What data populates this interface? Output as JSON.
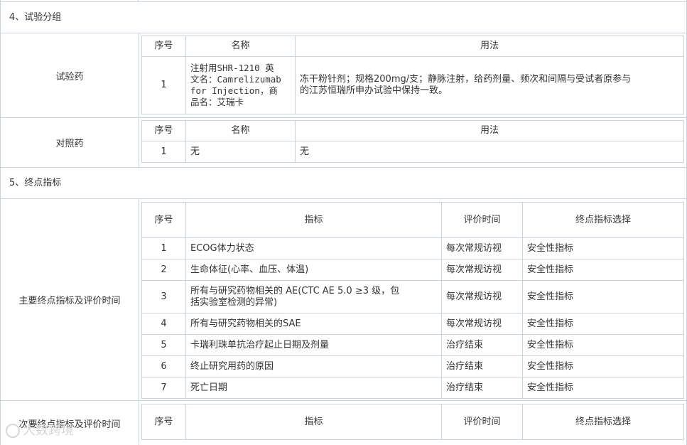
{
  "sections": {
    "grouping_title": "4、试验分组",
    "endpoints_title": "5、终点指标"
  },
  "test_drug": {
    "label": "试验药",
    "headers": [
      "序号",
      "名称",
      "用法"
    ],
    "rows": [
      {
        "no": "1",
        "name_lines": [
          "注射用SHR-1210 英",
          "文名：Camrelizumab",
          "for Injection，商",
          "品名：艾瑞卡"
        ],
        "usage_lines": [
          "冻干粉针剂；规格200mg/支；静脉注射，给药剂量、频次和间隔与受试者原参与",
          "的江苏恒瑞所申办试验中保持一致。"
        ]
      }
    ]
  },
  "control_drug": {
    "label": "对照药",
    "headers": [
      "序号",
      "名称",
      "用法"
    ],
    "rows": [
      {
        "no": "1",
        "name": "无",
        "usage": "无"
      }
    ]
  },
  "primary_endpoints": {
    "label": "主要终点指标及评价时间",
    "headers": [
      "序号",
      "指标",
      "评价时间",
      "终点指标选择"
    ],
    "rows": [
      {
        "no": "1",
        "indicator_lines": [
          "ECOG体力状态"
        ],
        "time": "每次常规访视",
        "type": "安全性指标"
      },
      {
        "no": "2",
        "indicator_lines": [
          "生命体征(心率、血压、体温)"
        ],
        "time": "每次常规访视",
        "type": "安全性指标"
      },
      {
        "no": "3",
        "indicator_lines": [
          "所有与研究药物相关的 AE(CTC AE 5.0 ≥3 级，包",
          "括实验室检测的异常)"
        ],
        "time": "每次常规访视",
        "type": "安全性指标"
      },
      {
        "no": "4",
        "indicator_lines": [
          "所有与研究药物相关的SAE"
        ],
        "time": "每次常规访视",
        "type": "安全性指标"
      },
      {
        "no": "5",
        "indicator_lines": [
          "卡瑞利珠单抗治疗起止日期及剂量"
        ],
        "time": "治疗结束",
        "type": "安全性指标"
      },
      {
        "no": "6",
        "indicator_lines": [
          "终止研究用药的原因"
        ],
        "time": "治疗结束",
        "type": "安全性指标"
      },
      {
        "no": "7",
        "indicator_lines": [
          "死亡日期"
        ],
        "time": "治疗结束",
        "type": "安全性指标"
      }
    ]
  },
  "secondary_endpoints": {
    "label": "次要终点指标及评价时间",
    "headers": [
      "序号",
      "指标",
      "评价时间",
      "终点指标选择"
    ]
  },
  "watermark": {
    "text": "大数跨境",
    "icon": "watermark-logo-icon"
  }
}
